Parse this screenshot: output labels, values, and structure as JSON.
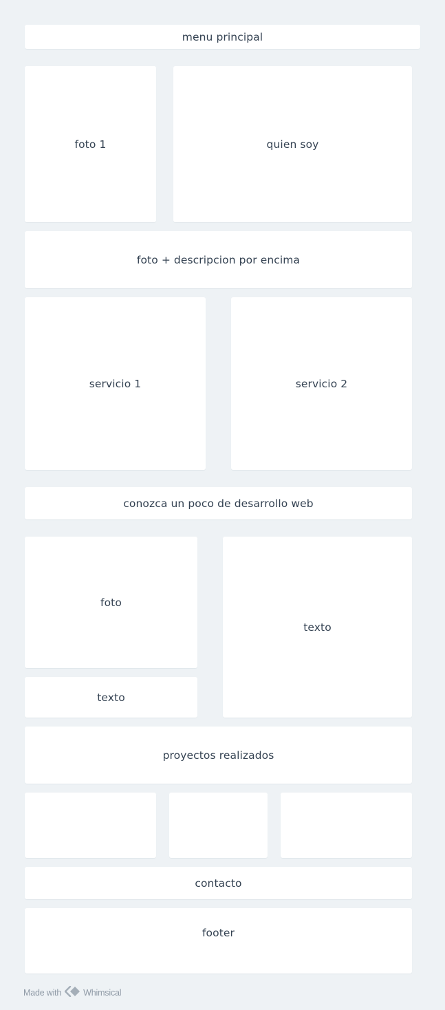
{
  "boxes": {
    "menu": "menu principal",
    "foto1": "foto 1",
    "quien": "quien soy",
    "fotodesc": "foto + descripcion por encima",
    "serv1": "servicio 1",
    "serv2": "servicio 2",
    "conozca": "conozca un poco de desarrollo web",
    "foto": "foto",
    "texto_small": "texto",
    "texto_big": "texto",
    "proyectos": "proyectos realizados",
    "contacto": "contacto",
    "footer": "footer"
  },
  "credit": {
    "prefix": "Made with",
    "brand": "Whimsical",
    "logo_icon": "whimsical-logo-icon"
  },
  "colors": {
    "background": "#eef2f5",
    "box": "#ffffff",
    "text": "#344252",
    "credit": "#8f9aa6"
  }
}
